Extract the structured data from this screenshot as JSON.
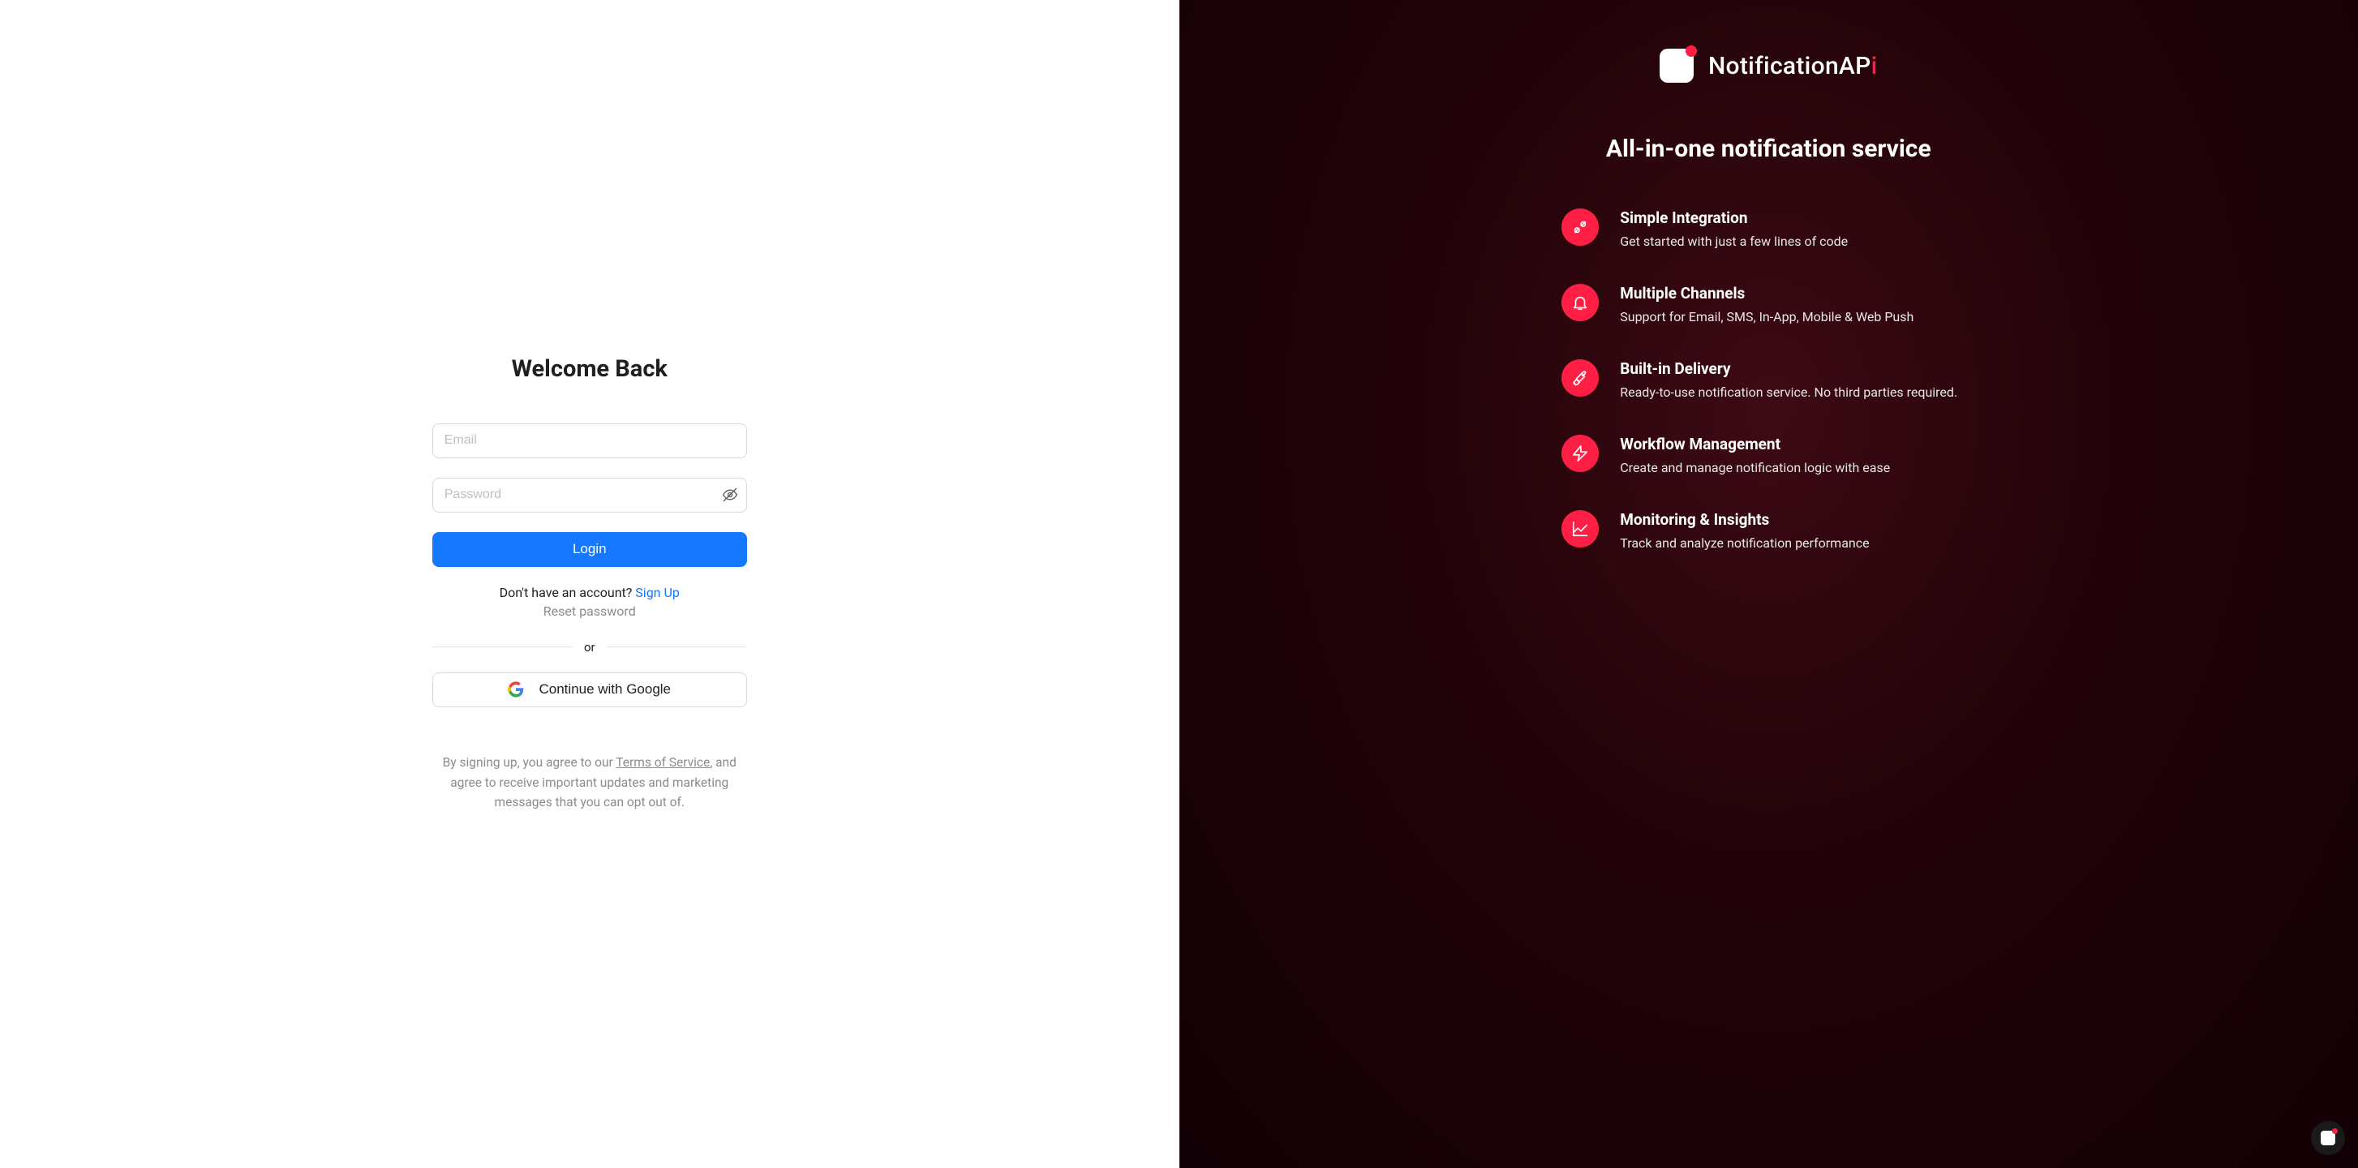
{
  "login": {
    "heading": "Welcome Back",
    "email_placeholder": "Email",
    "password_placeholder": "Password",
    "login_label": "Login",
    "signup_prefix": "Don't have an account? ",
    "signup_link": "Sign Up",
    "reset_link": "Reset password",
    "divider": "or",
    "google_label": "Continue with Google",
    "tos_prefix": "By signing up, you agree to our ",
    "tos_link": "Terms of Service",
    "tos_suffix": ", and agree to receive important updates and marketing messages that you can opt out of."
  },
  "marketing": {
    "brand_plain": "NotificationAP",
    "brand_accent": "i",
    "tagline": "All-in-one notification service",
    "features": [
      {
        "title": "Simple Integration",
        "desc": "Get started with just a few lines of code"
      },
      {
        "title": "Multiple Channels",
        "desc": "Support for Email, SMS, In-App, Mobile & Web Push"
      },
      {
        "title": "Built-in Delivery",
        "desc": "Ready-to-use notification service. No third parties required."
      },
      {
        "title": "Workflow Management",
        "desc": "Create and manage notification logic with ease"
      },
      {
        "title": "Monitoring & Insights",
        "desc": "Track and analyze notification performance"
      }
    ]
  },
  "colors": {
    "primary_blue": "#1677ff",
    "accent_red": "#ff1f44"
  }
}
